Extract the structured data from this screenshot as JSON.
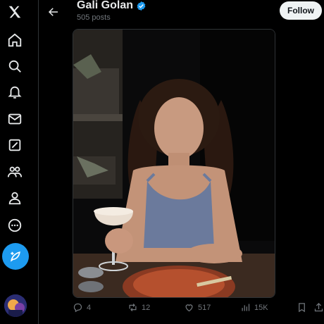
{
  "profile": {
    "name": "Gali Golan",
    "posts_count": "505 posts",
    "follow_label": "Follow",
    "verified": true
  },
  "sidebar": {
    "items": [
      {
        "icon": "x-logo-icon"
      },
      {
        "icon": "home-icon"
      },
      {
        "icon": "search-icon"
      },
      {
        "icon": "notifications-bell-icon"
      },
      {
        "icon": "messages-envelope-icon"
      },
      {
        "icon": "grok-icon"
      },
      {
        "icon": "communities-icon"
      },
      {
        "icon": "profile-icon"
      },
      {
        "icon": "more-circle-icon"
      }
    ],
    "post_button_icon": "compose-feather-icon"
  },
  "actions": {
    "replies": "4",
    "reposts": "12",
    "likes": "517",
    "views": "15K"
  },
  "colors": {
    "background": "#000000",
    "accent": "#1d9bf0",
    "muted_text": "#71767b",
    "primary_text": "#e7e9ea",
    "follow_button_bg": "#eff3f4"
  }
}
